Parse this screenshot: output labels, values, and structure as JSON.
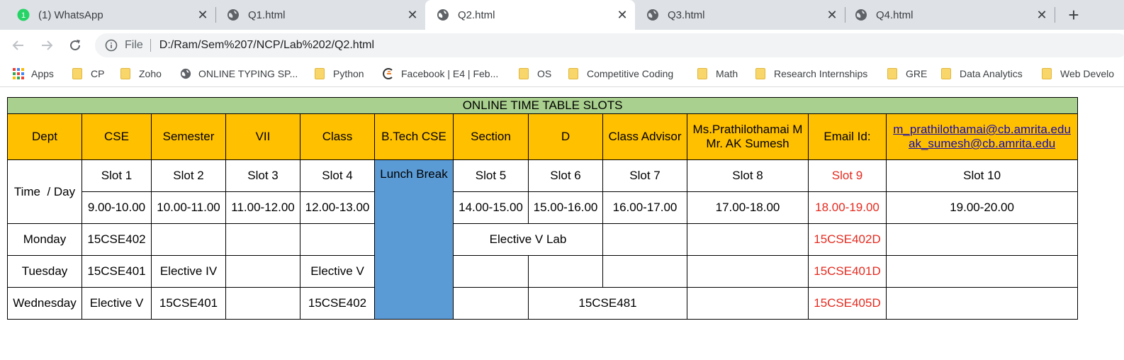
{
  "tabs": [
    {
      "title": "(1) WhatsApp",
      "icon": "whatsapp-icon",
      "active": false
    },
    {
      "title": "Q1.html",
      "icon": "globe-icon",
      "active": false
    },
    {
      "title": "Q2.html",
      "icon": "globe-icon",
      "active": true
    },
    {
      "title": "Q3.html",
      "icon": "globe-icon",
      "active": false
    },
    {
      "title": "Q4.html",
      "icon": "globe-icon",
      "active": false
    }
  ],
  "whatsapp_badge": "1",
  "address_bar": {
    "security_label": "File",
    "url": "D:/Ram/Sem%207/NCP/Lab%202/Q2.html"
  },
  "bookmarks": [
    {
      "label": "Apps",
      "icon": "apps-grid-icon"
    },
    {
      "label": "CP",
      "icon": "folder-icon"
    },
    {
      "label": "Zoho",
      "icon": "folder-icon"
    },
    {
      "label": "ONLINE TYPING SP...",
      "icon": "globe-icon"
    },
    {
      "label": "Python",
      "icon": "folder-icon"
    },
    {
      "label": "Facebook | E4 | Feb...",
      "icon": "bookmark-favicon-icon"
    },
    {
      "label": "OS",
      "icon": "folder-icon"
    },
    {
      "label": "Competitive Coding",
      "icon": "folder-icon"
    },
    {
      "label": "Math",
      "icon": "folder-icon"
    },
    {
      "label": "Research Internships",
      "icon": "folder-icon"
    },
    {
      "label": "GRE",
      "icon": "folder-icon"
    },
    {
      "label": "Data Analytics",
      "icon": "folder-icon"
    },
    {
      "label": "Web Develo",
      "icon": "folder-icon"
    }
  ],
  "timetable": {
    "title": "ONLINE TIME TABLE SLOTS",
    "header": {
      "dept_label": "Dept",
      "dept_value": "CSE",
      "semester_label": "Semester",
      "semester_value": "VII",
      "class_label": "Class",
      "class_value": "B.Tech CSE",
      "section_label": "Section",
      "section_value": "D",
      "advisor_label": "Class Advisor",
      "advisor_names": [
        "Ms.Prathilothamai M",
        "Mr. AK Sumesh"
      ],
      "email_label": "Email Id:",
      "emails": [
        "m_prathilothamai@cb.amrita.edu",
        "ak_sumesh@cb.amrita.edu"
      ]
    },
    "time_day_label": "Time  / Day",
    "slots": [
      "Slot 1",
      "Slot 2",
      "Slot 3",
      "Slot 4",
      "Slot 5",
      "Slot 6",
      "Slot 7",
      "Slot 8",
      "Slot 9",
      "Slot 10"
    ],
    "lunch_label": "Lunch Break",
    "times": [
      "9.00-10.00",
      "10.00-11.00",
      "11.00-12.00",
      "12.00-13.00",
      "14.00-15.00",
      "15.00-16.00",
      "16.00-17.00",
      "17.00-18.00",
      "18.00-19.00",
      "19.00-20.00"
    ],
    "days": {
      "monday": {
        "name": "Monday",
        "slot1": "15CSE402",
        "slot2": "",
        "slot3": "",
        "slot4": "",
        "slot5_6": "Elective V Lab",
        "slot7": "",
        "slot8": "",
        "slot9": "15CSE402D",
        "slot10": ""
      },
      "tuesday": {
        "name": "Tuesday",
        "slot1": "15CSE401",
        "slot2": "Elective IV",
        "slot3": "",
        "slot4": "Elective V",
        "slot5": "",
        "slot6": "",
        "slot7": "",
        "slot8": "",
        "slot9": "15CSE401D",
        "slot10": ""
      },
      "wednesday": {
        "name": "Wednesday",
        "slot1": "Elective V",
        "slot2": "15CSE401",
        "slot3": "",
        "slot4": "15CSE402",
        "slot5": "",
        "slot6_7": "15CSE481",
        "slot8": "",
        "slot9": "15CSE405D",
        "slot10": ""
      }
    },
    "colors": {
      "title_bg": "#a9d08e",
      "header_bg": "#ffc000",
      "lunch_bg": "#5b9bd5",
      "slot9_text": "#e52a1f"
    }
  }
}
